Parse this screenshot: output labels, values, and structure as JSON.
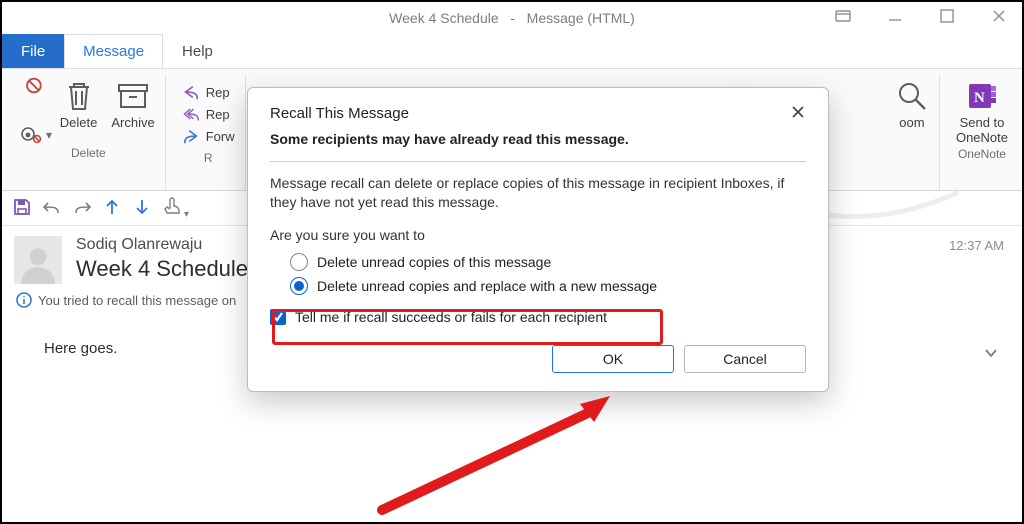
{
  "window": {
    "caption_left": "Week 4 Schedule",
    "caption_right": "Message (HTML)"
  },
  "tabs": {
    "file": "File",
    "message": "Message",
    "help": "Help"
  },
  "ribbon": {
    "delete": {
      "delete": "Delete",
      "archive": "Archive",
      "group": "Delete"
    },
    "respond": {
      "reply": "Reply",
      "replyall": "Reply All",
      "forward": "Forward",
      "group": "Respond"
    },
    "zoom": {
      "label": "Zoom",
      "cut": "oom"
    },
    "onenote": {
      "label": "Send to\nOneNote",
      "group": "OneNote"
    }
  },
  "message": {
    "sender": "Sodiq Olanrewaju",
    "subject": "Week 4 Schedule",
    "timestamp": "12:37 AM",
    "banner": "You tried to recall this message on",
    "body": "Here goes."
  },
  "dialog": {
    "title": "Recall This Message",
    "heading": "Some recipients may have already read this message.",
    "explain": "Message recall can delete or replace copies of this message in recipient Inboxes, if they have not yet read this message.",
    "prompt": "Are you sure you want to",
    "opt1": "Delete unread copies of this message",
    "opt2": "Delete unread copies and replace with a new message",
    "check": "Tell me if recall succeeds or fails for each recipient",
    "ok": "OK",
    "cancel": "Cancel"
  }
}
